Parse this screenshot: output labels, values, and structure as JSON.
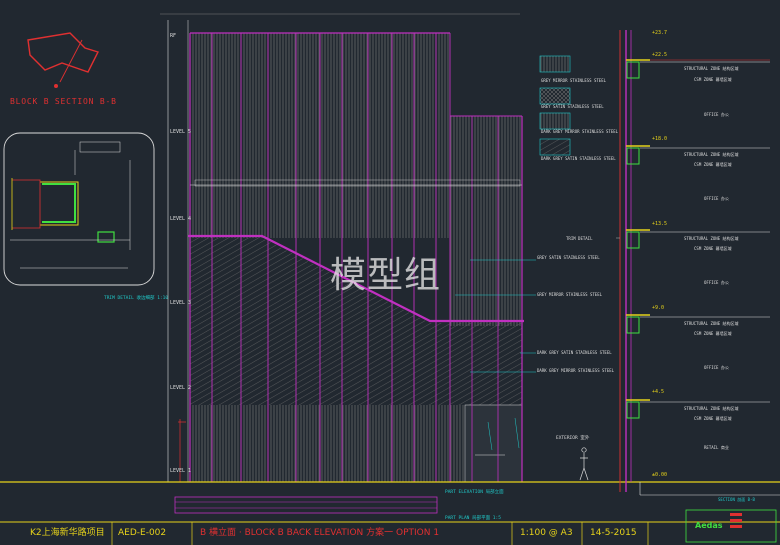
{
  "colors": {
    "bg": "#212830",
    "red": "#e03030",
    "magenta": "#c030c0",
    "yellow": "#e6d21a",
    "cyan": "#20c8c8",
    "green": "#40e040",
    "white": "#dcdcdc",
    "hatch": "#8a8a8a"
  },
  "block_label": "BLOCK B SECTION B-B",
  "trim_detail": "TRIM DETAIL 收边细部 1:10",
  "level_labels": [
    "RF",
    "LEVEL 5",
    "LEVEL 4",
    "LEVEL 3",
    "LEVEL 2",
    "LEVEL 1"
  ],
  "material_legend": [
    "GREY MIRROR STAINLESS STEEL",
    "GREY SATIN STAINLESS STEEL",
    "DARK GREY MIRROR STAINLESS STEEL",
    "DARK GREY SATIN STAINLESS STEEL"
  ],
  "callouts": [
    "GREY SATIN STAINLESS STEEL",
    "GREY MIRROR STAINLESS STEEL",
    "DARK GREY SATIN STAINLESS STEEL",
    "DARK GREY MIRROR STAINLESS STEEL"
  ],
  "elevations": [
    "+23.7",
    "+22.5",
    "+18.0",
    "+13.5",
    "+9.0",
    "+4.5",
    "±0.00"
  ],
  "zones": {
    "structural": "STRUCTURAL ZONE 结构区域",
    "csm": "CSM ZONE 幕墙区域",
    "office": "OFFICE 办公",
    "retail": "RETAIL 商业"
  },
  "trim_label": "TRIM DETAIL",
  "exterior": "EXTERIOR 室外",
  "part_elevation": "PART ELEVATION 局部立面",
  "part_plan": "PART PLAN 局部平面 1:5",
  "section_label": "SECTION 剖面 B-B",
  "watermark": "模型组",
  "titleblock": {
    "project": "K2上海新华路项目",
    "code": "AED-E-002",
    "title": "B 横立面 · BLOCK B BACK ELEVATION 方案一 OPTION 1",
    "scale": "1:100 @ A3",
    "date": "14-5-2015",
    "logo": "Aedas"
  }
}
